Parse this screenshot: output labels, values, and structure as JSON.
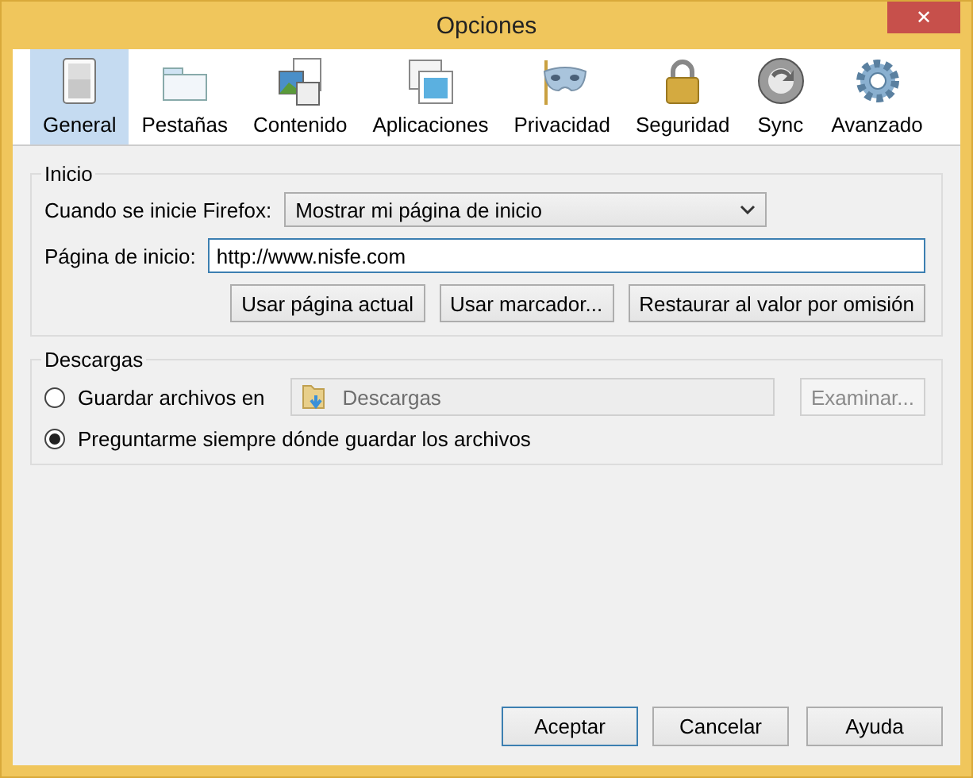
{
  "window": {
    "title": "Opciones",
    "close": "✕"
  },
  "tabs": [
    {
      "label": "General",
      "selected": true
    },
    {
      "label": "Pestañas",
      "selected": false
    },
    {
      "label": "Contenido",
      "selected": false
    },
    {
      "label": "Aplicaciones",
      "selected": false
    },
    {
      "label": "Privacidad",
      "selected": false
    },
    {
      "label": "Seguridad",
      "selected": false
    },
    {
      "label": "Sync",
      "selected": false
    },
    {
      "label": "Avanzado",
      "selected": false
    }
  ],
  "inicio": {
    "title": "Inicio",
    "startup_label": "Cuando se inicie Firefox:",
    "startup_value": "Mostrar mi página de inicio",
    "home_label": "Página de inicio:",
    "home_value": "http://www.nisfe.com",
    "buttons": [
      "Usar página actual",
      "Usar marcador...",
      "Restaurar al valor por omisión"
    ]
  },
  "descargas": {
    "title": "Descargas",
    "options": [
      {
        "label": "Guardar archivos en",
        "selected": false
      },
      {
        "label": "Preguntarme siempre dónde guardar los archivos",
        "selected": true
      }
    ],
    "folder": {
      "value": "Descargas",
      "disabled": true
    },
    "browse": {
      "label": "Examinar...",
      "disabled": true
    }
  },
  "buttons": [
    {
      "label": "Aceptar",
      "default": true
    },
    {
      "label": "Cancelar",
      "default": false
    },
    {
      "label": "Ayuda",
      "default": false
    }
  ]
}
